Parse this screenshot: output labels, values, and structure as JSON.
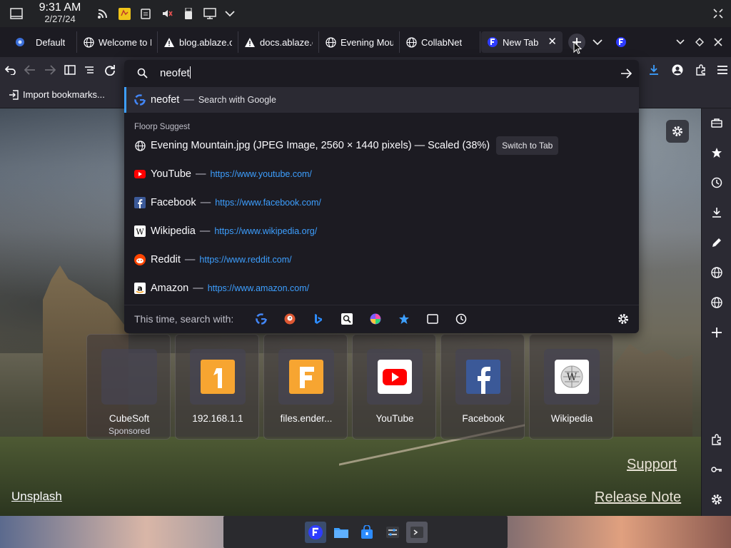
{
  "system_bar": {
    "time": "9:31 AM",
    "date": "2/27/24",
    "icons": [
      "show-desktop-icon",
      "rss-icon",
      "sticky-note-icon",
      "clipboard-icon",
      "volume-muted-icon",
      "usb-drive-icon",
      "display-icon",
      "chevron-down-icon",
      "settings-icon"
    ]
  },
  "tabs": {
    "workspace": "Default",
    "items": [
      {
        "label": "Welcome to F",
        "icon": "globe-icon"
      },
      {
        "label": "blog.ablaze.o",
        "icon": "warning-icon"
      },
      {
        "label": "docs.ablaze.o",
        "icon": "warning-icon"
      },
      {
        "label": "Evening Mou",
        "icon": "globe-icon"
      },
      {
        "label": "CollabNet",
        "icon": "globe-icon"
      },
      {
        "label": "New Tab",
        "icon": "floorp-icon",
        "active": true
      }
    ]
  },
  "bookmarks": {
    "import_label": "Import bookmarks..."
  },
  "urlbar": {
    "query": "neofet",
    "first_result": {
      "term": "neofet",
      "separator": "—",
      "action": "Search with Google"
    },
    "suggest_heading": "Floorp Suggest",
    "results": [
      {
        "title": "Evening Mountain.jpg (JPEG Image, 2560 × 1440 pixels) — Scaled (38%)",
        "action": "Switch to Tab",
        "icon": "globe-icon"
      },
      {
        "title": "YouTube",
        "separator": "—",
        "url": "https://www.youtube.com/",
        "icon": "youtube-icon"
      },
      {
        "title": "Facebook",
        "separator": "—",
        "url": "https://www.facebook.com/",
        "icon": "facebook-icon"
      },
      {
        "title": "Wikipedia",
        "separator": "—",
        "url": "https://www.wikipedia.org/",
        "icon": "wikipedia-icon"
      },
      {
        "title": "Reddit",
        "separator": "—",
        "url": "https://www.reddit.com/",
        "icon": "reddit-icon"
      },
      {
        "title": "Amazon",
        "separator": "—",
        "url": "https://www.amazon.com/",
        "icon": "amazon-icon"
      }
    ],
    "one_off_label": "This time, search with:",
    "engines": [
      "google-icon",
      "duckduckgo-icon",
      "bing-icon",
      "search-engine-icon",
      "ai-search-icon",
      "bookmarks-icon",
      "tabs-icon",
      "history-icon"
    ]
  },
  "top_sites": [
    {
      "name": "CubeSoft",
      "sponsor": "Sponsored"
    },
    {
      "name": "192.168.1.1"
    },
    {
      "name": "files.ender..."
    },
    {
      "name": "YouTube"
    },
    {
      "name": "Facebook"
    },
    {
      "name": "Wikipedia"
    }
  ],
  "links": {
    "unsplash": "Unsplash",
    "support": "Support",
    "release_note": "Release Note"
  },
  "colors": {
    "accent": "#3d9fff",
    "panel": "#1c1b22",
    "toolbar": "#2b2a33"
  }
}
